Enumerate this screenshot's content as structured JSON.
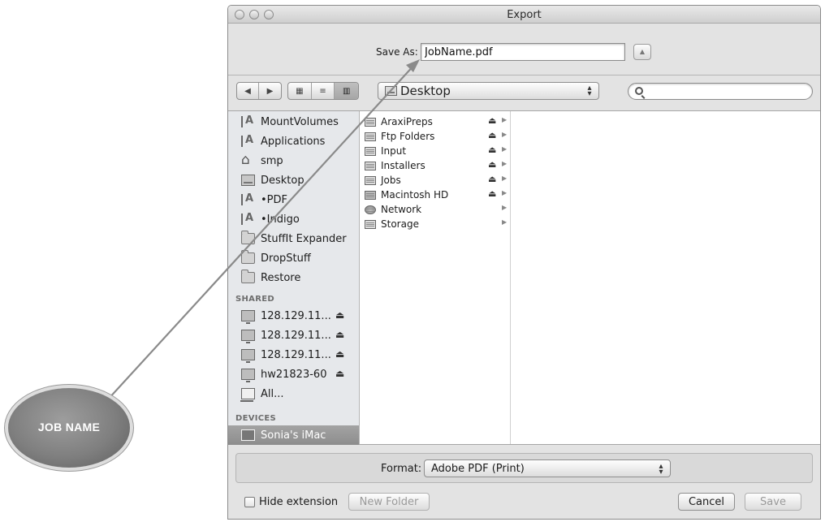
{
  "window": {
    "title": "Export"
  },
  "save_as": {
    "label": "Save As:",
    "value": "JobName.pdf"
  },
  "toolbar": {
    "back_icon": "◀",
    "forward_icon": "▶",
    "view_icons": [
      "▦",
      "≡",
      "▥"
    ],
    "location": "Desktop",
    "search_placeholder": ""
  },
  "sidebar": {
    "favorites": [
      {
        "label": "MountVolumes",
        "icon": "application-icon"
      },
      {
        "label": "Applications",
        "icon": "application-icon"
      },
      {
        "label": "smp",
        "icon": "home-icon"
      },
      {
        "label": "Desktop",
        "icon": "desktop-icon"
      },
      {
        "label": "•PDF",
        "icon": "application-icon"
      },
      {
        "label": "•Indigo",
        "icon": "application-icon"
      },
      {
        "label": "StuffIt Expander",
        "icon": "folder-icon"
      },
      {
        "label": "DropStuff",
        "icon": "folder-icon"
      },
      {
        "label": "Restore",
        "icon": "folder-icon"
      }
    ],
    "shared_heading": "SHARED",
    "shared": [
      {
        "label": "128.129.11...",
        "eject": "⏏"
      },
      {
        "label": "128.129.11...",
        "eject": "⏏"
      },
      {
        "label": "128.129.11...",
        "eject": "⏏"
      },
      {
        "label": "hw21823-60",
        "eject": "⏏"
      },
      {
        "label": "All...",
        "eject": ""
      }
    ],
    "devices_heading": "DEVICES",
    "devices": [
      {
        "label": "Sonia's iMac",
        "selected": true
      }
    ]
  },
  "column1": [
    {
      "label": "AraxiPreps",
      "eject": "⏏",
      "arrow": "▶"
    },
    {
      "label": "Ftp Folders",
      "eject": "⏏",
      "arrow": "▶"
    },
    {
      "label": "Input",
      "eject": "⏏",
      "arrow": "▶"
    },
    {
      "label": "Installers",
      "eject": "⏏",
      "arrow": "▶"
    },
    {
      "label": "Jobs",
      "eject": "⏏",
      "arrow": "▶"
    },
    {
      "label": "Macintosh HD",
      "eject": "⏏",
      "arrow": "▶"
    },
    {
      "label": "Network",
      "eject": "",
      "arrow": "▶"
    },
    {
      "label": "Storage",
      "eject": "",
      "arrow": "▶"
    }
  ],
  "format": {
    "label": "Format:",
    "value": "Adobe PDF (Print)"
  },
  "bottom": {
    "hide_extension": "Hide extension",
    "hide_extension_checked": false,
    "new_folder": "New Folder",
    "cancel": "Cancel",
    "save": "Save"
  },
  "annotation": {
    "label": "JOB NAME"
  },
  "colors": {
    "annotation_bubble": "#7f7f7f",
    "sidebar_selected": "#979797",
    "sidebar_bg": "#e6e8eb"
  }
}
